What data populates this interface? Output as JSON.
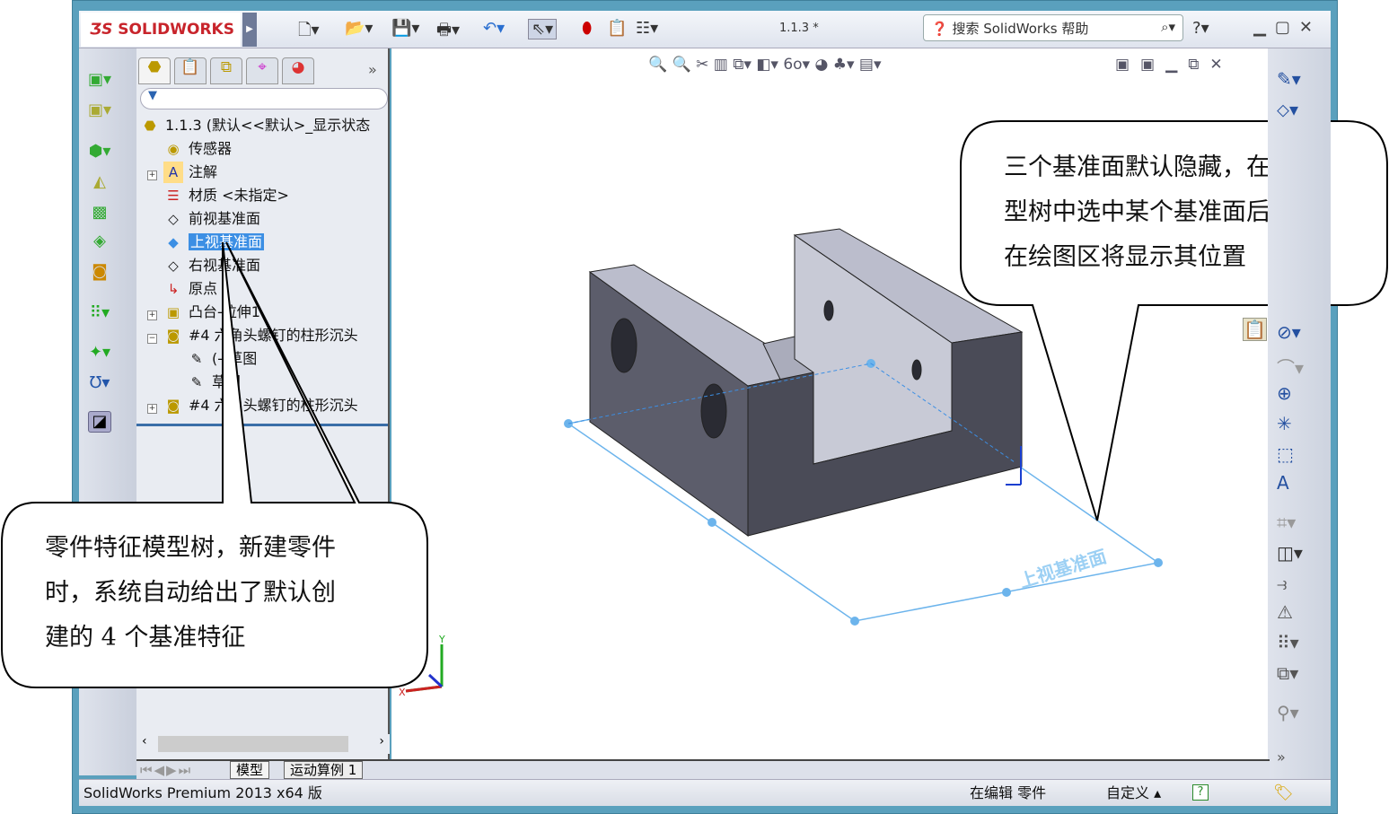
{
  "app": {
    "logo": "SOLIDWORKS",
    "title": "1.1.3 *",
    "search_placeholder": "搜索 SolidWorks 帮助",
    "help": "?"
  },
  "tree": {
    "tabs": [
      "feature-manager",
      "property-manager",
      "configuration-manager",
      "dimxpert-manager",
      "display-manager"
    ],
    "more": "»",
    "nodes": [
      {
        "label": "1.1.3  (默认<<默认>_显示状态",
        "icon": "part-icon"
      },
      {
        "label": "传感器",
        "icon": "sensor-folder-icon"
      },
      {
        "label": "注解",
        "icon": "annotation-folder-icon"
      },
      {
        "label": "材质 <未指定>",
        "icon": "material-icon"
      },
      {
        "label": "前视基准面",
        "icon": "plane-icon"
      },
      {
        "label": "上视基准面",
        "icon": "plane-icon",
        "selected": true
      },
      {
        "label": "右视基准面",
        "icon": "plane-icon"
      },
      {
        "label": "原点",
        "icon": "origin-icon"
      },
      {
        "label": "凸台-拉伸1",
        "icon": "extrude-icon"
      },
      {
        "label": "#4 六角头螺钉的柱形沉头",
        "icon": "hole-wizard-icon"
      },
      {
        "label": "(-)草图",
        "icon": "sketch-icon"
      },
      {
        "label": "草图",
        "icon": "sketch-icon"
      },
      {
        "label": "#4 六角头螺钉的柱形沉头",
        "icon": "hole-wizard-icon"
      }
    ]
  },
  "bottom_tabs": {
    "model": "模型",
    "motion": "运动算例 1"
  },
  "viewport": {
    "plane_label": "上视基准面",
    "axis_x": "X",
    "axis_y": "Y"
  },
  "callouts": {
    "right": [
      "三个基准面默认隐藏，在模",
      "型树中选中某个基准面后，",
      "在绘图区将显示其位置"
    ],
    "left": [
      "零件特征模型树，新建零件",
      "时，系统自动给出了默认创",
      "建的 4 个基准特征"
    ]
  },
  "status": {
    "product": "SolidWorks Premium 2013 x64 版",
    "editing": "在编辑 零件",
    "units": "自定义",
    "help": "?"
  },
  "colors": {
    "frame": "#5aa0bd",
    "selection": "#3c8fe4",
    "plane": "#6cb4ec",
    "part": "#4a4b57"
  }
}
